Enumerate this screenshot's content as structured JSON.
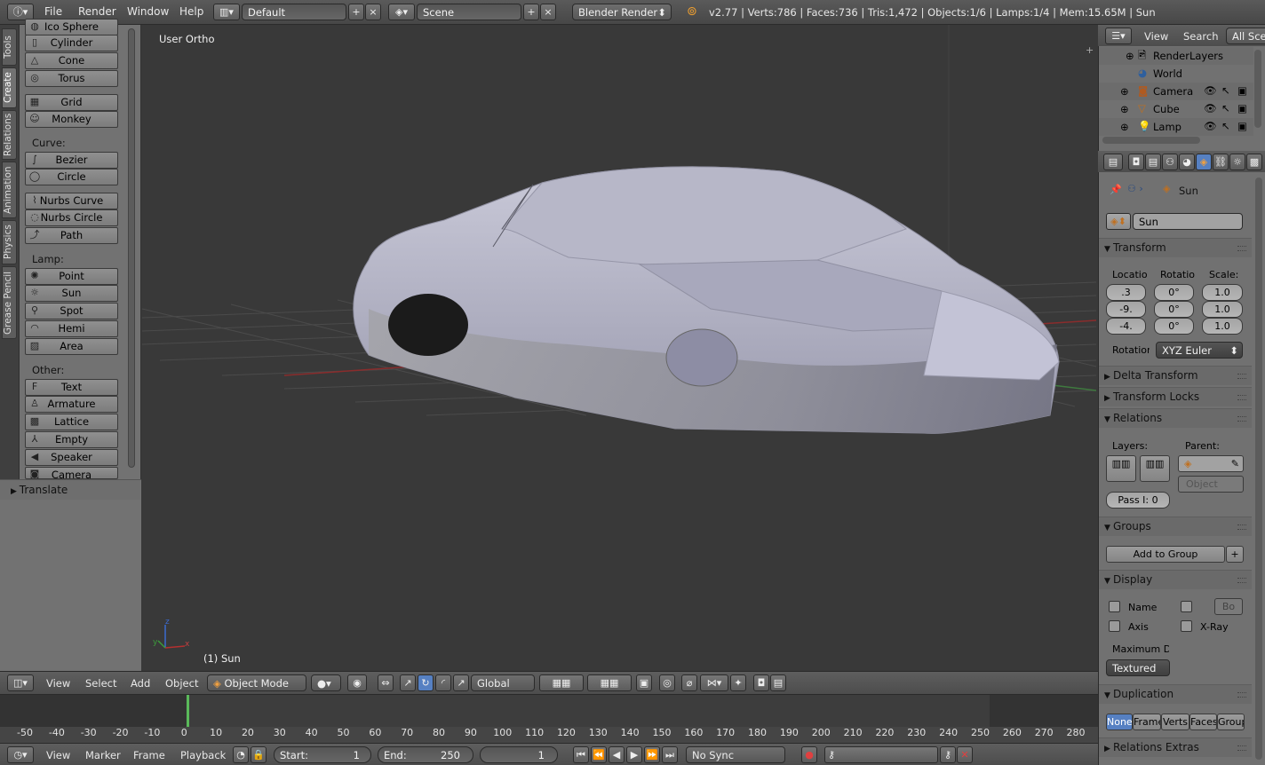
{
  "topbar": {
    "menus": [
      "File",
      "Render",
      "Window",
      "Help"
    ],
    "screen_layout": "Default",
    "scene": "Scene",
    "render_engine": "Blender Render",
    "stats": "v2.77 | Verts:786 | Faces:736 | Tris:1,472 | Objects:1/6 | Lamps:1/4 | Mem:15.65M | Sun"
  },
  "tabs": [
    "Tools",
    "Create",
    "Relations",
    "Animation",
    "Physics",
    "Grease Pencil"
  ],
  "shelf": {
    "mesh_items": [
      "Ico Sphere",
      "Cylinder",
      "Cone",
      "Torus",
      "Grid",
      "Monkey"
    ],
    "curve_label": "Curve:",
    "curve_items": [
      "Bezier",
      "Circle",
      "Nurbs Curve",
      "Nurbs Circle",
      "Path"
    ],
    "lamp_label": "Lamp:",
    "lamp_items": [
      "Point",
      "Sun",
      "Spot",
      "Hemi",
      "Area"
    ],
    "other_label": "Other:",
    "other_items": [
      "Text",
      "Armature",
      "Lattice",
      "Empty",
      "Speaker",
      "Camera"
    ],
    "operator_panel": "Translate"
  },
  "viewport": {
    "view_name": "User Ortho",
    "object_label": "(1) Sun"
  },
  "viewport_header": {
    "menus": [
      "View",
      "Select",
      "Add",
      "Object"
    ],
    "mode": "Object Mode",
    "orientation": "Global"
  },
  "timeline": {
    "ticks": [
      "-50",
      "-40",
      "-30",
      "-20",
      "-10",
      "0",
      "10",
      "20",
      "30",
      "40",
      "50",
      "60",
      "70",
      "80",
      "90",
      "100",
      "110",
      "120",
      "130",
      "140",
      "150",
      "160",
      "170",
      "180",
      "190",
      "200",
      "210",
      "220",
      "230",
      "240",
      "250",
      "260",
      "270",
      "280"
    ],
    "current_frame": 1
  },
  "timeline_header": {
    "menus": [
      "View",
      "Marker",
      "Frame",
      "Playback"
    ],
    "start_label": "Start:",
    "start": "1",
    "end_label": "End:",
    "end": "250",
    "frame": "1",
    "sync": "No Sync"
  },
  "outliner": {
    "menus": [
      "View",
      "Search"
    ],
    "filter": "All Scenes",
    "items": [
      "RenderLayers",
      "World",
      "Camera",
      "Cube",
      "Lamp"
    ]
  },
  "properties": {
    "breadcrumb": "Sun",
    "object_name": "Sun",
    "transform": {
      "title": "Transform",
      "location_label": "Location:",
      "rotation_label": "Rotation:",
      "scale_label": "Scale:",
      "location": [
        ".3",
        "-9.",
        "-4."
      ],
      "rotation": [
        "0°",
        "0°",
        "0°"
      ],
      "scale": [
        "1.0",
        "1.0",
        "1.0"
      ],
      "rotation_mode_label": "Rotation Mode:",
      "rotation_mode": "XYZ Euler"
    },
    "delta_transform": "Delta Transform",
    "transform_locks": "Transform Locks",
    "relations": {
      "title": "Relations",
      "layers_label": "Layers:",
      "parent_label": "Parent:",
      "parent_type": "Object",
      "pass_index": "Pass I: 0"
    },
    "groups": {
      "title": "Groups",
      "add_button": "Add to Group"
    },
    "display": {
      "title": "Display",
      "name": "Name",
      "axis": "Axis",
      "bounds": "Bo",
      "xray": "X-Ray",
      "max_draw_label": "Maximum Draw Type:",
      "max_draw": "Textured"
    },
    "duplication": {
      "title": "Duplication",
      "options": [
        "None",
        "Frames",
        "Verts",
        "Faces",
        "Group"
      ]
    },
    "relations_extras": "Relations Extras"
  }
}
